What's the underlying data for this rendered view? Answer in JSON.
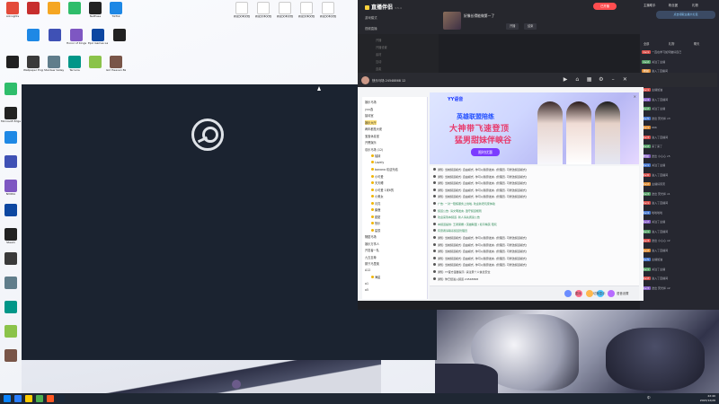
{
  "desktop": {
    "icons_row1": [
      "Arknights",
      "",
      "",
      "",
      "NetEase",
      "TikTok"
    ],
    "icons_row2": [
      "",
      "",
      "Honor of Kings",
      "Epic Games Launcher",
      ""
    ],
    "icons_row3": [
      "",
      "Wallpaper Engine",
      "Stardew Valley",
      "Terraria",
      "",
      "Girl Heaven Backrooms"
    ],
    "files_top": [
      "新建文本文档",
      "新建文本文档",
      "新建文本文档",
      "新建文本文档",
      "新建文本文档"
    ],
    "left_column": [
      "",
      "Microsoft Edge",
      "",
      "",
      "NVIDIA",
      "",
      "Steam",
      "",
      "",
      "",
      "",
      ""
    ]
  },
  "live_app": {
    "logo": "直播伴侣",
    "version": "3.5.4",
    "nav": [
      "游戏模式",
      "视频直播"
    ],
    "stream_title": "好像长得能做第一了",
    "btn_start": "开播",
    "btn_end": "结束",
    "channel": "王者荣耀 · 排位",
    "red_btn": "已开播",
    "gray_rows": [
      "开播",
      "开播设置",
      "素材",
      "互动",
      "连麦"
    ],
    "right_panel": {
      "tabs": [
        "主播助手",
        "粉丝团",
        "礼物"
      ],
      "badge": "点击领取主播大礼包",
      "sub_tabs": [
        "全部",
        "礼物",
        "聊天"
      ],
      "messages": [
        {
          "tag": "Lv.1",
          "color": "red",
          "text": "一直在学习如何做好自己"
        },
        {
          "tag": "Lv.2",
          "color": "green",
          "text": "关注了主播"
        },
        {
          "tag": "粉丝",
          "color": "orange",
          "text": "进入了直播间"
        },
        {
          "tag": "Lv.3",
          "color": "blue",
          "text": "送出 小心心 x1"
        },
        {
          "tag": "Lv.1",
          "color": "red",
          "text": "主播加油"
        },
        {
          "tag": "Lv.4",
          "color": "purple",
          "text": "进入了直播间"
        },
        {
          "tag": "Lv.2",
          "color": "green",
          "text": "关注了主播"
        },
        {
          "tag": "Lv.5",
          "color": "blue",
          "text": "送出 荧光棒 x3"
        },
        {
          "tag": "Lv.1",
          "color": "orange",
          "text": "666"
        },
        {
          "tag": "Lv.3",
          "color": "red",
          "text": "进入了直播间"
        },
        {
          "tag": "Lv.2",
          "color": "green",
          "text": "来了来了"
        },
        {
          "tag": "粉丝",
          "color": "purple",
          "text": "送出 小心心 x5"
        },
        {
          "tag": "Lv.1",
          "color": "blue",
          "text": "关注了主播"
        },
        {
          "tag": "Lv.6",
          "color": "red",
          "text": "进入了直播间"
        },
        {
          "tag": "Lv.2",
          "color": "orange",
          "text": "主播好厉害"
        },
        {
          "tag": "Lv.3",
          "color": "green",
          "text": "送出 荧光棒 x1"
        },
        {
          "tag": "Lv.1",
          "color": "red",
          "text": "进入了直播间"
        },
        {
          "tag": "Lv.4",
          "color": "blue",
          "text": "哈哈哈哈"
        },
        {
          "tag": "Lv.2",
          "color": "purple",
          "text": "关注了主播"
        },
        {
          "tag": "Lv.1",
          "color": "green",
          "text": "进入了直播间"
        },
        {
          "tag": "Lv.3",
          "color": "red",
          "text": "送出 小心心 x2"
        },
        {
          "tag": "Lv.2",
          "color": "orange",
          "text": "进入了直播间"
        },
        {
          "tag": "Lv.5",
          "color": "blue",
          "text": "主播加油"
        },
        {
          "tag": "Lv.1",
          "color": "green",
          "text": "关注了主播"
        },
        {
          "tag": "Lv.2",
          "color": "red",
          "text": "进入了直播间"
        },
        {
          "tag": "Lv.3",
          "color": "purple",
          "text": "送出 荧光棒 x2"
        }
      ]
    }
  },
  "yy": {
    "room_name": "快乐马场",
    "room_id": "24548868",
    "online": "12",
    "tree": [
      {
        "text": "娱乐马场",
        "hl": false,
        "dot": false
      },
      {
        "text": "yuu选",
        "hl": false,
        "dot": false
      },
      {
        "text": "接待室",
        "hl": false,
        "dot": false
      },
      {
        "text": "娱乐大厅",
        "hl": true,
        "dot": false
      },
      {
        "text": "两年都是大佬",
        "hl": false,
        "dot": false
      },
      {
        "text": "宝宝休息室",
        "hl": false,
        "dot": false
      },
      {
        "text": "开黑娱乐",
        "hl": false,
        "dot": false
      },
      {
        "text": "欢乐马场 (12)",
        "hl": false,
        "dot": false
      },
      {
        "text": "柚妹",
        "hl": false,
        "dot": true
      },
      {
        "text": "Lovely",
        "hl": false,
        "dot": true
      },
      {
        "text": "banana 欢迎光临",
        "hl": false,
        "dot": true
      },
      {
        "text": "小可爱",
        "hl": false,
        "dot": true
      },
      {
        "text": "天天睡",
        "hl": false,
        "dot": true
      },
      {
        "text": "小可爱 1米6的",
        "hl": false,
        "dot": true
      },
      {
        "text": "小美女",
        "hl": false,
        "dot": true
      },
      {
        "text": "月亮",
        "hl": false,
        "dot": true
      },
      {
        "text": "麋鹿",
        "hl": false,
        "dot": true
      },
      {
        "text": "甜甜",
        "hl": false,
        "dot": true
      },
      {
        "text": "快乐",
        "hl": false,
        "dot": true
      },
      {
        "text": "星辰",
        "hl": false,
        "dot": true
      },
      {
        "text": "隔壁马场",
        "hl": false,
        "dot": false
      },
      {
        "text": "娱乐万事人",
        "hl": false,
        "dot": false
      },
      {
        "text": "开发者一队",
        "hl": false,
        "dot": false
      },
      {
        "text": "九五至尊",
        "hl": false,
        "dot": false
      },
      {
        "text": "那只马里奥",
        "hl": false,
        "dot": false
      },
      {
        "text": "A12",
        "hl": false,
        "dot": false
      },
      {
        "text": "海星",
        "hl": false,
        "dot": true
      },
      {
        "text": "a1",
        "hl": false,
        "dot": false
      },
      {
        "text": "a5",
        "hl": false,
        "dot": false
      }
    ],
    "ad": {
      "brand": "YY语音",
      "line1": "英雄联盟陪练",
      "line2": "大神带飞速登顶",
      "line3": "猛男甜妹伴峡谷",
      "button": "限时优惠"
    },
    "chat_lines": [
      {
        "green": false,
        "text": "通知: 当前频道模式: 自由模式, 你可以随意发言, [管理员, 可修改频道模式]"
      },
      {
        "green": false,
        "text": "通知: 当前频道模式: 自由模式, 你可以随意发言, [管理员, 可修改频道模式]"
      },
      {
        "green": false,
        "text": "通知: 当前频道模式: 自由模式, 你可以随意发言, [管理员, 可修改频道模式]"
      },
      {
        "green": false,
        "text": "通知: 当前频道模式: 自由模式, 你可以随意发言, [管理员, 可修改频道模式]"
      },
      {
        "green": false,
        "text": "通知: 当前频道模式: 自由模式, 你可以随意发言, [管理员, 可修改频道模式]"
      },
      {
        "green": true,
        "text": "广告: 一对一陪练服务上线啦, 欢迎新老玩家体验"
      },
      {
        "green": true,
        "text": "频道公告: 请文明发言, 遵守频道规则"
      },
      {
        "green": true,
        "text": "欢迎来到本频道, 新人请先阅读公告"
      },
      {
        "green": true,
        "text": "本频道提供: 王者荣耀 / 英雄联盟 / 和平精英 陪玩"
      },
      {
        "green": true,
        "text": "有意者请联系频道管理员"
      },
      {
        "green": false,
        "text": "通知: 当前频道模式: 自由模式, 你可以随意发言, [管理员, 可修改频道模式]"
      },
      {
        "green": false,
        "text": "通知: 当前频道模式: 自由模式, 你可以随意发言, [管理员, 可修改频道模式]"
      },
      {
        "green": false,
        "text": "通知: 当前频道模式: 自由模式, 你可以随意发言, [管理员, 可修改频道模式]"
      },
      {
        "green": false,
        "text": "通知: 当前频道模式: 自由模式, 你可以随意发言, [管理员, 可修改频道模式]"
      },
      {
        "green": false,
        "text": "通知: 当前频道模式: 自由模式, 你可以随意发言, [管理员, 可修改频道模式]"
      },
      {
        "green": false,
        "text": "通知: YY官方温馨提示, 请注意个人信息安全"
      },
      {
        "green": false,
        "text": "通知: 你已经进入频道 24548868"
      }
    ],
    "bottom_right": [
      "麦序",
      "切换显示",
      "语音设置"
    ]
  },
  "taskbar": {
    "time": "22:40",
    "date": "2023/12/26",
    "tray_text": "中"
  }
}
